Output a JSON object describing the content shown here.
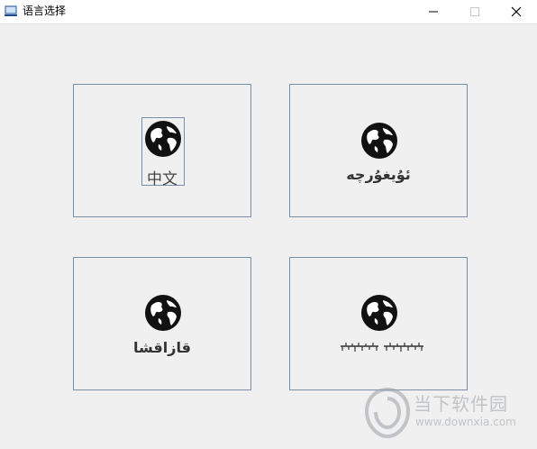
{
  "window": {
    "title": "语言选择",
    "controls": [
      "minimize",
      "maximize",
      "close"
    ]
  },
  "languages": [
    {
      "label": "中文",
      "icon": "globe-icon",
      "selected": true
    },
    {
      "label": "ئۇيغۇرچە",
      "icon": "globe-icon",
      "selected": false
    },
    {
      "label": "قازاقشا",
      "icon": "globe-icon",
      "selected": false
    },
    {
      "label": "ᠮᠣᠩᠭᠣᠯ ᠬᠡᠯᠡ",
      "icon": "globe-icon",
      "selected": false,
      "rendered_as_script_graphic": true
    }
  ],
  "watermark": {
    "title": "当下软件园",
    "url": "www.downxia.com"
  },
  "colors": {
    "background": "#f0f0f0",
    "titlebar": "#ffffff",
    "border": "#7a8ea8",
    "label": "#333333"
  }
}
